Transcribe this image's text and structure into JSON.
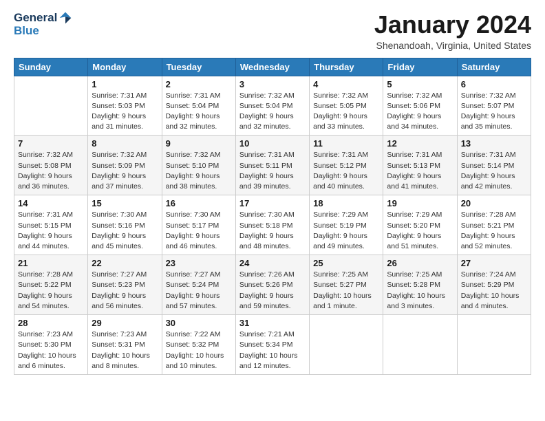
{
  "header": {
    "logo_general": "General",
    "logo_blue": "Blue",
    "month_title": "January 2024",
    "location": "Shenandoah, Virginia, United States"
  },
  "days_of_week": [
    "Sunday",
    "Monday",
    "Tuesday",
    "Wednesday",
    "Thursday",
    "Friday",
    "Saturday"
  ],
  "weeks": [
    [
      {
        "num": "",
        "sunrise": "",
        "sunset": "",
        "daylight": ""
      },
      {
        "num": "1",
        "sunrise": "Sunrise: 7:31 AM",
        "sunset": "Sunset: 5:03 PM",
        "daylight": "Daylight: 9 hours and 31 minutes."
      },
      {
        "num": "2",
        "sunrise": "Sunrise: 7:31 AM",
        "sunset": "Sunset: 5:04 PM",
        "daylight": "Daylight: 9 hours and 32 minutes."
      },
      {
        "num": "3",
        "sunrise": "Sunrise: 7:32 AM",
        "sunset": "Sunset: 5:04 PM",
        "daylight": "Daylight: 9 hours and 32 minutes."
      },
      {
        "num": "4",
        "sunrise": "Sunrise: 7:32 AM",
        "sunset": "Sunset: 5:05 PM",
        "daylight": "Daylight: 9 hours and 33 minutes."
      },
      {
        "num": "5",
        "sunrise": "Sunrise: 7:32 AM",
        "sunset": "Sunset: 5:06 PM",
        "daylight": "Daylight: 9 hours and 34 minutes."
      },
      {
        "num": "6",
        "sunrise": "Sunrise: 7:32 AM",
        "sunset": "Sunset: 5:07 PM",
        "daylight": "Daylight: 9 hours and 35 minutes."
      }
    ],
    [
      {
        "num": "7",
        "sunrise": "Sunrise: 7:32 AM",
        "sunset": "Sunset: 5:08 PM",
        "daylight": "Daylight: 9 hours and 36 minutes."
      },
      {
        "num": "8",
        "sunrise": "Sunrise: 7:32 AM",
        "sunset": "Sunset: 5:09 PM",
        "daylight": "Daylight: 9 hours and 37 minutes."
      },
      {
        "num": "9",
        "sunrise": "Sunrise: 7:32 AM",
        "sunset": "Sunset: 5:10 PM",
        "daylight": "Daylight: 9 hours and 38 minutes."
      },
      {
        "num": "10",
        "sunrise": "Sunrise: 7:31 AM",
        "sunset": "Sunset: 5:11 PM",
        "daylight": "Daylight: 9 hours and 39 minutes."
      },
      {
        "num": "11",
        "sunrise": "Sunrise: 7:31 AM",
        "sunset": "Sunset: 5:12 PM",
        "daylight": "Daylight: 9 hours and 40 minutes."
      },
      {
        "num": "12",
        "sunrise": "Sunrise: 7:31 AM",
        "sunset": "Sunset: 5:13 PM",
        "daylight": "Daylight: 9 hours and 41 minutes."
      },
      {
        "num": "13",
        "sunrise": "Sunrise: 7:31 AM",
        "sunset": "Sunset: 5:14 PM",
        "daylight": "Daylight: 9 hours and 42 minutes."
      }
    ],
    [
      {
        "num": "14",
        "sunrise": "Sunrise: 7:31 AM",
        "sunset": "Sunset: 5:15 PM",
        "daylight": "Daylight: 9 hours and 44 minutes."
      },
      {
        "num": "15",
        "sunrise": "Sunrise: 7:30 AM",
        "sunset": "Sunset: 5:16 PM",
        "daylight": "Daylight: 9 hours and 45 minutes."
      },
      {
        "num": "16",
        "sunrise": "Sunrise: 7:30 AM",
        "sunset": "Sunset: 5:17 PM",
        "daylight": "Daylight: 9 hours and 46 minutes."
      },
      {
        "num": "17",
        "sunrise": "Sunrise: 7:30 AM",
        "sunset": "Sunset: 5:18 PM",
        "daylight": "Daylight: 9 hours and 48 minutes."
      },
      {
        "num": "18",
        "sunrise": "Sunrise: 7:29 AM",
        "sunset": "Sunset: 5:19 PM",
        "daylight": "Daylight: 9 hours and 49 minutes."
      },
      {
        "num": "19",
        "sunrise": "Sunrise: 7:29 AM",
        "sunset": "Sunset: 5:20 PM",
        "daylight": "Daylight: 9 hours and 51 minutes."
      },
      {
        "num": "20",
        "sunrise": "Sunrise: 7:28 AM",
        "sunset": "Sunset: 5:21 PM",
        "daylight": "Daylight: 9 hours and 52 minutes."
      }
    ],
    [
      {
        "num": "21",
        "sunrise": "Sunrise: 7:28 AM",
        "sunset": "Sunset: 5:22 PM",
        "daylight": "Daylight: 9 hours and 54 minutes."
      },
      {
        "num": "22",
        "sunrise": "Sunrise: 7:27 AM",
        "sunset": "Sunset: 5:23 PM",
        "daylight": "Daylight: 9 hours and 56 minutes."
      },
      {
        "num": "23",
        "sunrise": "Sunrise: 7:27 AM",
        "sunset": "Sunset: 5:24 PM",
        "daylight": "Daylight: 9 hours and 57 minutes."
      },
      {
        "num": "24",
        "sunrise": "Sunrise: 7:26 AM",
        "sunset": "Sunset: 5:26 PM",
        "daylight": "Daylight: 9 hours and 59 minutes."
      },
      {
        "num": "25",
        "sunrise": "Sunrise: 7:25 AM",
        "sunset": "Sunset: 5:27 PM",
        "daylight": "Daylight: 10 hours and 1 minute."
      },
      {
        "num": "26",
        "sunrise": "Sunrise: 7:25 AM",
        "sunset": "Sunset: 5:28 PM",
        "daylight": "Daylight: 10 hours and 3 minutes."
      },
      {
        "num": "27",
        "sunrise": "Sunrise: 7:24 AM",
        "sunset": "Sunset: 5:29 PM",
        "daylight": "Daylight: 10 hours and 4 minutes."
      }
    ],
    [
      {
        "num": "28",
        "sunrise": "Sunrise: 7:23 AM",
        "sunset": "Sunset: 5:30 PM",
        "daylight": "Daylight: 10 hours and 6 minutes."
      },
      {
        "num": "29",
        "sunrise": "Sunrise: 7:23 AM",
        "sunset": "Sunset: 5:31 PM",
        "daylight": "Daylight: 10 hours and 8 minutes."
      },
      {
        "num": "30",
        "sunrise": "Sunrise: 7:22 AM",
        "sunset": "Sunset: 5:32 PM",
        "daylight": "Daylight: 10 hours and 10 minutes."
      },
      {
        "num": "31",
        "sunrise": "Sunrise: 7:21 AM",
        "sunset": "Sunset: 5:34 PM",
        "daylight": "Daylight: 10 hours and 12 minutes."
      },
      {
        "num": "",
        "sunrise": "",
        "sunset": "",
        "daylight": ""
      },
      {
        "num": "",
        "sunrise": "",
        "sunset": "",
        "daylight": ""
      },
      {
        "num": "",
        "sunrise": "",
        "sunset": "",
        "daylight": ""
      }
    ]
  ]
}
